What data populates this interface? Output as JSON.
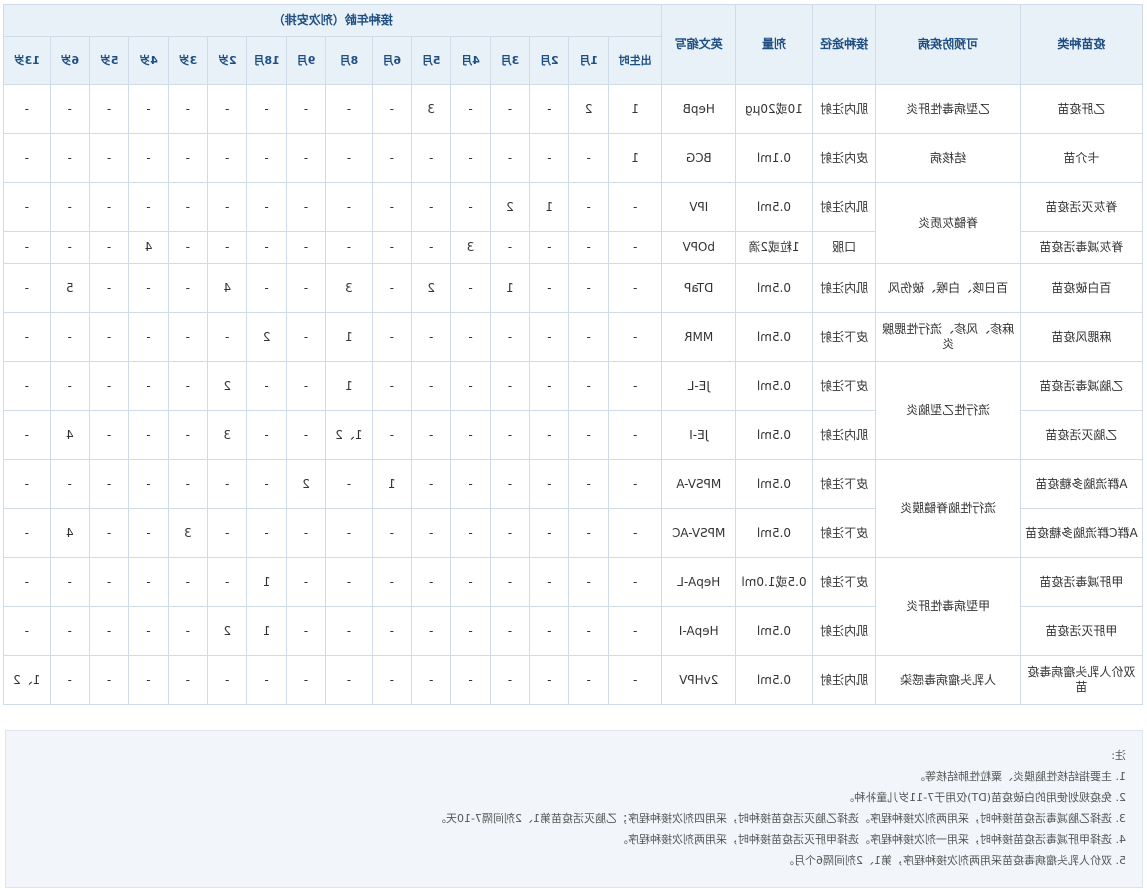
{
  "header": {
    "vaccine": "疫苗种类",
    "disease": "可预防疾病",
    "route": "接种途径",
    "dose": "剂量",
    "abbr": "英文缩写",
    "age_group": "接种年龄（剂次安排）",
    "ages": [
      "出生时",
      "1月",
      "2月",
      "3月",
      "4月",
      "5月",
      "6月",
      "8月",
      "9月",
      "18月",
      "2岁",
      "3岁",
      "4岁",
      "5岁",
      "6岁",
      "13岁"
    ]
  },
  "rows": [
    {
      "vaccine": "乙肝疫苗",
      "disease": "乙型病毒性肝炎",
      "route": "肌内注射",
      "dose": "10或20μg",
      "abbr": "HepB",
      "doses": [
        "1",
        "2",
        "-",
        "-",
        "-",
        "3",
        "-",
        "-",
        "-",
        "-",
        "-",
        "-",
        "-",
        "-",
        "-",
        "-"
      ]
    },
    {
      "vaccine": "卡介苗",
      "disease": "结核病",
      "route": "皮内注射",
      "dose": "0.1ml",
      "abbr": "BCG",
      "doses": [
        "1",
        "-",
        "-",
        "-",
        "-",
        "-",
        "-",
        "-",
        "-",
        "-",
        "-",
        "-",
        "-",
        "-",
        "-",
        "-"
      ]
    },
    {
      "vaccine": "脊灰灭活疫苗",
      "disease": "脊髓灰质炎",
      "route": "肌内注射",
      "dose": "0.5ml",
      "abbr": "IPV",
      "doses": [
        "-",
        "-",
        "1",
        "2",
        "-",
        "-",
        "-",
        "-",
        "-",
        "-",
        "-",
        "-",
        "-",
        "-",
        "-",
        "-"
      ]
    },
    {
      "vaccine": "脊灰减毒活疫苗",
      "route": "口服",
      "dose": "1粒或2滴",
      "abbr": "bOPV",
      "doses": [
        "-",
        "-",
        "-",
        "-",
        "3",
        "-",
        "-",
        "-",
        "-",
        "-",
        "-",
        "-",
        "4",
        "-",
        "-",
        "-"
      ]
    },
    {
      "vaccine": "百白破疫苗",
      "disease": "百日咳、白喉、破伤风",
      "route": "肌内注射",
      "dose": "0.5ml",
      "abbr": "DTaP",
      "doses": [
        "-",
        "-",
        "-",
        "1",
        "-",
        "2",
        "-",
        "3",
        "-",
        "-",
        "4",
        "-",
        "-",
        "-",
        "5",
        "-"
      ]
    },
    {
      "vaccine": "麻腮风疫苗",
      "disease": "麻疹、风疹、流行性腮腺炎",
      "route": "皮下注射",
      "dose": "0.5ml",
      "abbr": "MMR",
      "doses": [
        "-",
        "-",
        "-",
        "-",
        "-",
        "-",
        "-",
        "1",
        "-",
        "2",
        "-",
        "-",
        "-",
        "-",
        "-",
        "-"
      ]
    },
    {
      "vaccine": "乙脑减毒活疫苗",
      "disease": "流行性乙型脑炎",
      "route": "皮下注射",
      "dose": "0.5ml",
      "abbr": "JE-L",
      "doses": [
        "-",
        "-",
        "-",
        "-",
        "-",
        "-",
        "-",
        "1",
        "-",
        "-",
        "2",
        "-",
        "-",
        "-",
        "-",
        "-"
      ]
    },
    {
      "vaccine": "乙脑灭活疫苗",
      "route": "肌内注射",
      "dose": "0.5ml",
      "abbr": "JE-I",
      "doses": [
        "-",
        "-",
        "-",
        "-",
        "-",
        "-",
        "-",
        "1、2",
        "-",
        "-",
        "3",
        "-",
        "-",
        "-",
        "4",
        "-"
      ]
    },
    {
      "vaccine": "A群流脑多糖疫苗",
      "disease": "流行性脑脊髓膜炎",
      "route": "皮下注射",
      "dose": "0.5ml",
      "abbr": "MPSV-A",
      "doses": [
        "-",
        "-",
        "-",
        "-",
        "-",
        "-",
        "1",
        "-",
        "2",
        "-",
        "-",
        "-",
        "-",
        "-",
        "-",
        "-"
      ]
    },
    {
      "vaccine": "A群C群流脑多糖疫苗",
      "route": "皮下注射",
      "dose": "0.5ml",
      "abbr": "MPSV-AC",
      "doses": [
        "-",
        "-",
        "-",
        "-",
        "-",
        "-",
        "-",
        "-",
        "-",
        "-",
        "-",
        "3",
        "-",
        "-",
        "4",
        "-"
      ]
    },
    {
      "vaccine": "甲肝减毒活疫苗",
      "disease": "甲型病毒性肝炎",
      "route": "皮下注射",
      "dose": "0.5或1.0ml",
      "abbr": "HepA-L",
      "doses": [
        "-",
        "-",
        "-",
        "-",
        "-",
        "-",
        "-",
        "-",
        "-",
        "1",
        "-",
        "-",
        "-",
        "-",
        "-",
        "-"
      ]
    },
    {
      "vaccine": "甲肝灭活疫苗",
      "route": "肌内注射",
      "dose": "0.5ml",
      "abbr": "HepA-I",
      "doses": [
        "-",
        "-",
        "-",
        "-",
        "-",
        "-",
        "-",
        "-",
        "-",
        "1",
        "2",
        "-",
        "-",
        "-",
        "-",
        "-"
      ]
    },
    {
      "vaccine": "双价人乳头瘤病毒疫苗",
      "disease": "人乳头瘤病毒感染",
      "route": "肌内注射",
      "dose": "0.5ml",
      "abbr": "2vHPV",
      "doses": [
        "-",
        "-",
        "-",
        "-",
        "-",
        "-",
        "-",
        "-",
        "-",
        "-",
        "-",
        "-",
        "-",
        "-",
        "-",
        "1、2"
      ]
    }
  ],
  "notes": {
    "title": "注:",
    "items": [
      "1. 主要指结核性脑膜炎、粟粒性肺结核等。",
      "2. 免疫规划使用的白破疫苗(DT)仅用于7-11岁儿童补种。",
      "3. 选择乙脑减毒活疫苗接种时，采用两剂次接种程序。选择乙脑灭活疫苗接种时，采用四剂次接种程序；乙脑灭活疫苗第1、2剂间隔7-10天。",
      "4. 选择甲肝减毒活疫苗接种时，采用一剂次接种程序。选择甲肝灭活疫苗接种时，采用两剂次接种程序。",
      "5. 双价人乳头瘤病毒疫苗采用两剂次接种程序，第1、2剂间隔6个月。"
    ]
  }
}
